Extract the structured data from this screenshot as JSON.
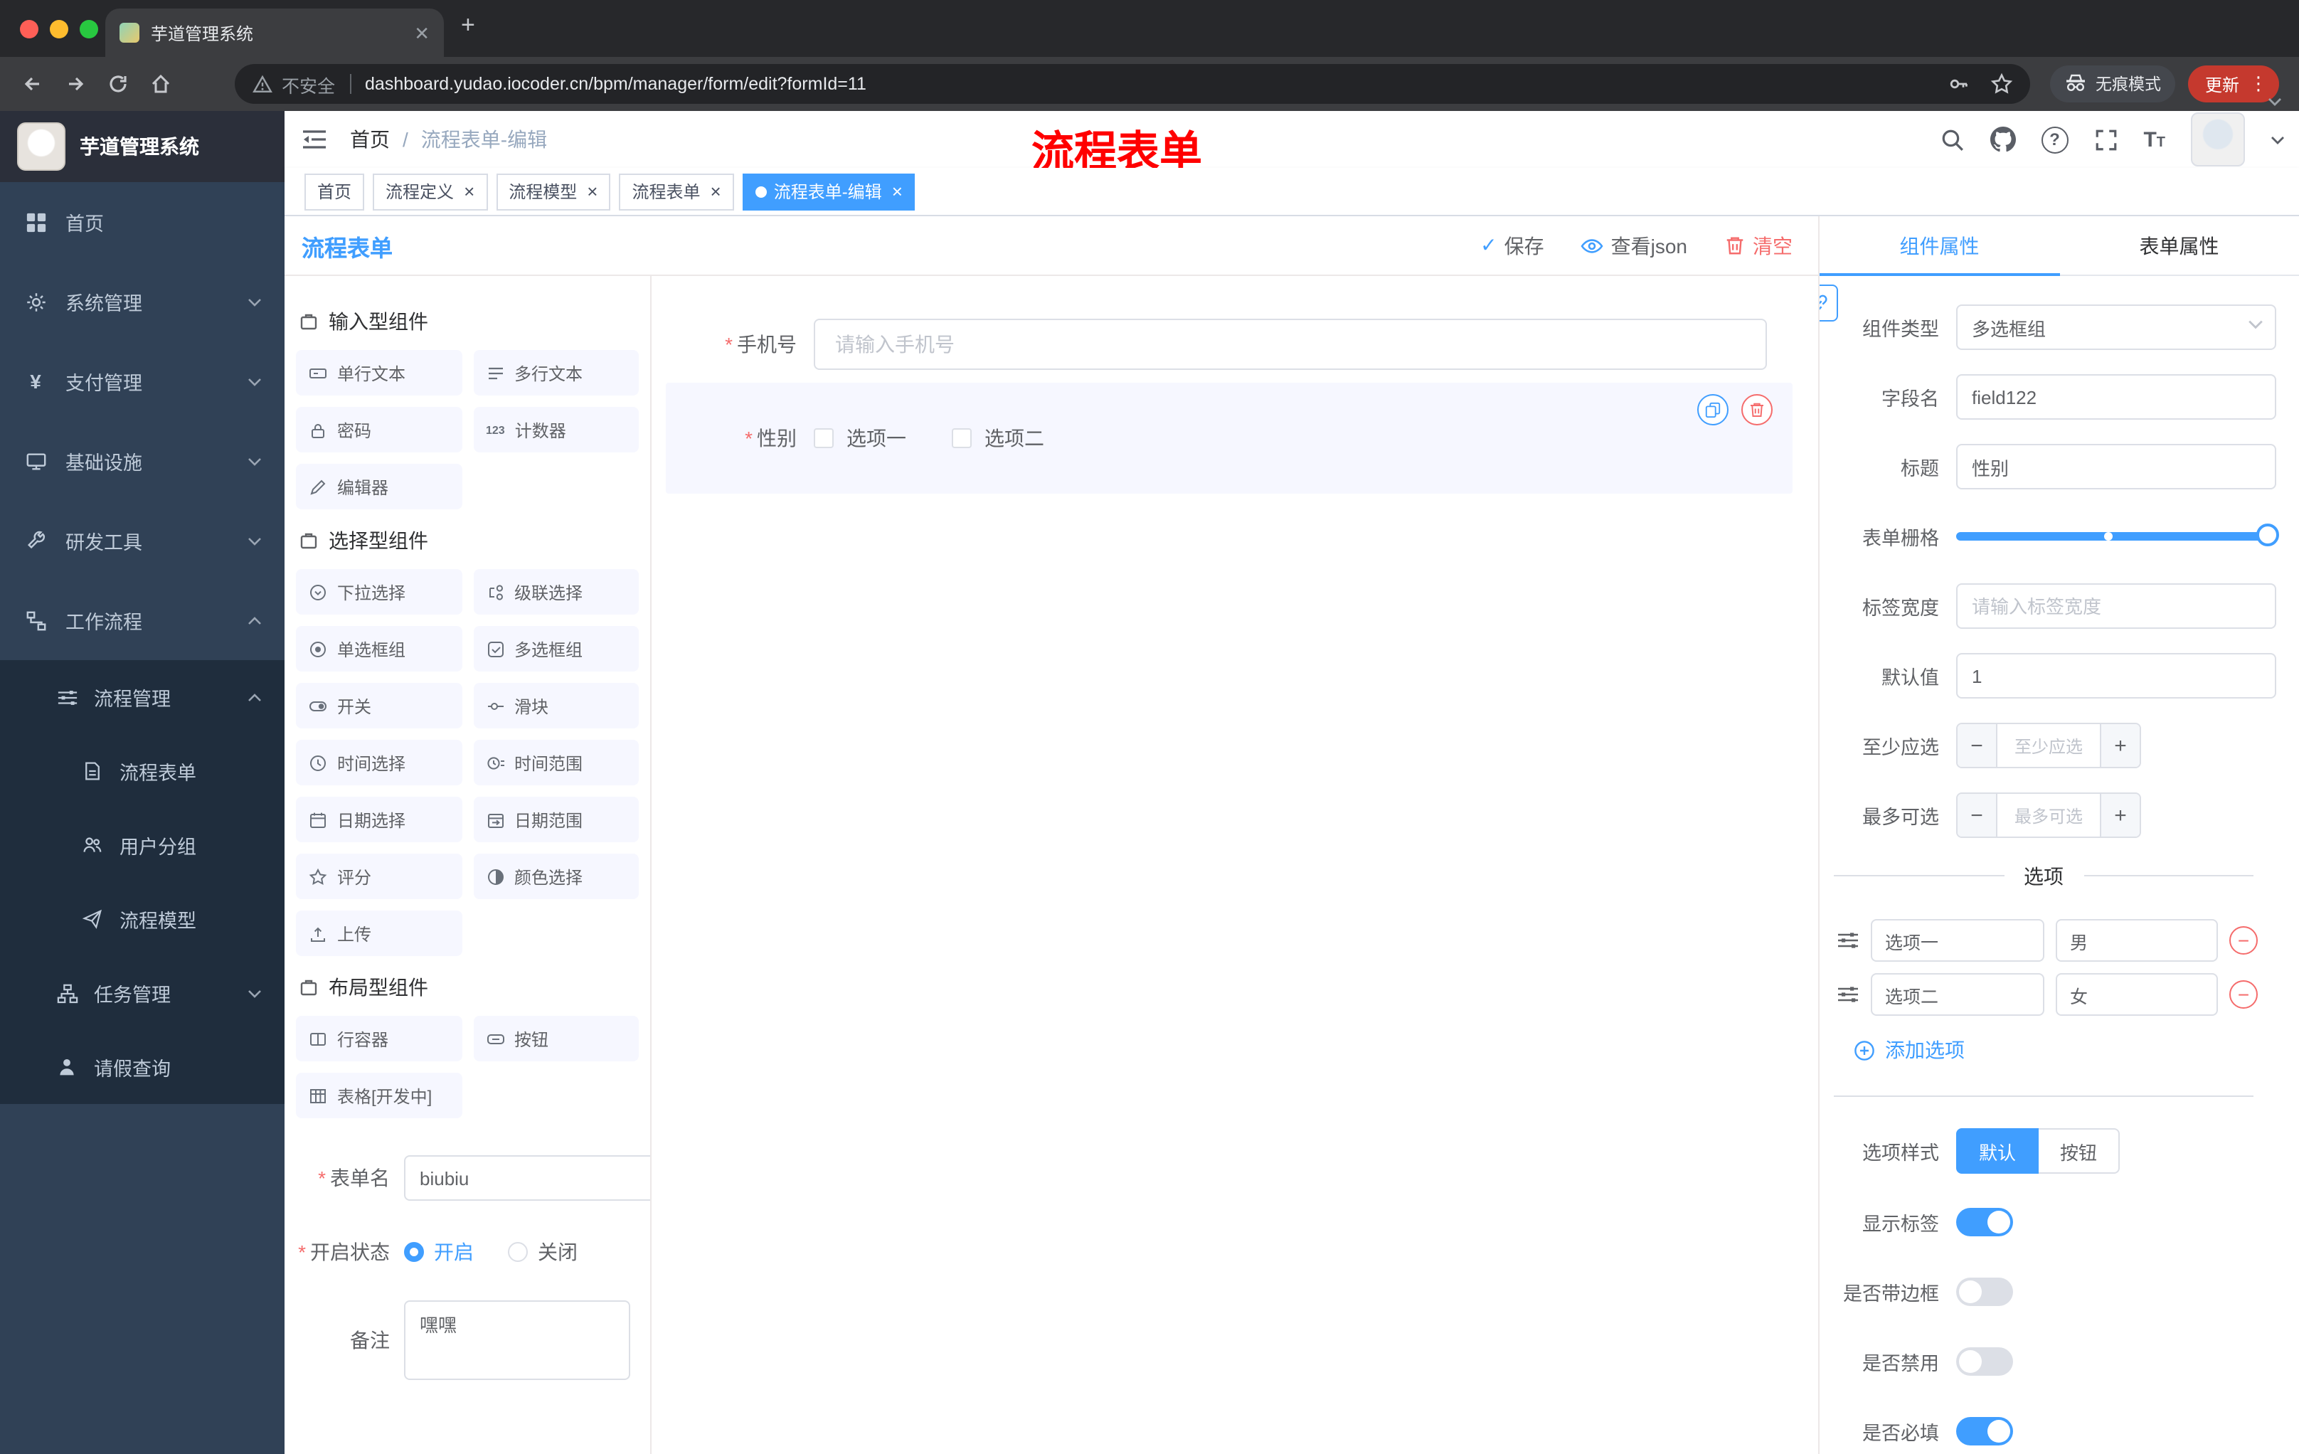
{
  "colors": {
    "primary": "#409EFF",
    "danger": "#F56C6C",
    "update_red": "#C5392E",
    "sidebar_bg": "#304156",
    "submenu_bg": "#1F2D3D"
  },
  "browser": {
    "tab_title": "芋道管理系统",
    "security_label": "不安全",
    "url": "dashboard.yudao.iocoder.cn/bpm/manager/form/edit?formId=11",
    "incognito_label": "无痕模式",
    "update_label": "更新",
    "icons": [
      "back-icon",
      "forward-icon",
      "reload-icon",
      "home-icon",
      "warning-icon",
      "key-icon",
      "star-icon",
      "incognito-icon",
      "more-icon"
    ]
  },
  "sidebar": {
    "logo_title": "芋道管理系统",
    "menu": [
      {
        "label": "首页",
        "icon": "dashboard-icon",
        "chevron": null
      },
      {
        "label": "系统管理",
        "icon": "gear-icon",
        "chevron": "down"
      },
      {
        "label": "支付管理",
        "icon": "yen-icon",
        "chevron": "down"
      },
      {
        "label": "基础设施",
        "icon": "monitor-icon",
        "chevron": "down"
      },
      {
        "label": "研发工具",
        "icon": "wrench-icon",
        "chevron": "down"
      },
      {
        "label": "工作流程",
        "icon": "workflow-icon",
        "chevron": "up",
        "expanded": true
      }
    ],
    "submenu": [
      {
        "label": "流程管理",
        "icon": "operation-icon",
        "chevron": "up",
        "level": 1
      },
      {
        "label": "流程表单",
        "icon": "form-icon",
        "level": 2
      },
      {
        "label": "用户分组",
        "icon": "user-group-icon",
        "level": 2
      },
      {
        "label": "流程模型",
        "icon": "send-icon",
        "level": 2
      },
      {
        "label": "任务管理",
        "icon": "tree-icon",
        "chevron": "down",
        "level": 1
      },
      {
        "label": "请假查询",
        "icon": "person-icon",
        "level": 1
      }
    ]
  },
  "header": {
    "breadcrumb": {
      "root": "首页",
      "separator": "/",
      "current": "流程表单-编辑"
    },
    "annotation": "流程表单",
    "icons": [
      "search-icon",
      "github-icon",
      "question-icon",
      "fullscreen-icon",
      "font-size-icon",
      "avatar",
      "caret-down-icon"
    ]
  },
  "tags": [
    {
      "label": "首页",
      "closable": false,
      "active": false
    },
    {
      "label": "流程定义",
      "closable": true,
      "active": false
    },
    {
      "label": "流程模型",
      "closable": true,
      "active": false
    },
    {
      "label": "流程表单",
      "closable": true,
      "active": false
    },
    {
      "label": "流程表单-编辑",
      "closable": true,
      "active": true
    }
  ],
  "designer": {
    "panel_title": "流程表单",
    "toolbar": {
      "save": "保存",
      "view_json": "查看json",
      "clear": "清空"
    },
    "groups": [
      {
        "title": "输入型组件",
        "items": [
          "单行文本",
          "多行文本",
          "密码",
          "计数器",
          "编辑器"
        ]
      },
      {
        "title": "选择型组件",
        "items": [
          "下拉选择",
          "级联选择",
          "单选框组",
          "多选框组",
          "开关",
          "滑块",
          "时间选择",
          "时间范围",
          "日期选择",
          "日期范围",
          "评分",
          "颜色选择",
          "上传"
        ]
      },
      {
        "title": "布局型组件",
        "items": [
          "行容器",
          "按钮",
          "表格[开发中]"
        ]
      }
    ],
    "form_meta": {
      "name_label": "表单名",
      "name_value": "biubiu",
      "status_label": "开启状态",
      "status_options": [
        "开启",
        "关闭"
      ],
      "status_selected": "开启",
      "remark_label": "备注",
      "remark_value": "嘿嘿"
    },
    "canvas": {
      "phone_label": "手机号",
      "phone_placeholder": "请输入手机号",
      "gender_label": "性别",
      "gender_options": [
        "选项一",
        "选项二"
      ]
    }
  },
  "properties": {
    "tabs": [
      {
        "label": "组件属性",
        "active": true
      },
      {
        "label": "表单属性",
        "active": false
      }
    ],
    "component_type": {
      "label": "组件类型",
      "value": "多选框组"
    },
    "field_name": {
      "label": "字段名",
      "value": "field122"
    },
    "title": {
      "label": "标题",
      "value": "性别"
    },
    "grid": {
      "label": "表单栅格"
    },
    "label_width": {
      "label": "标签宽度",
      "placeholder": "请输入标签宽度"
    },
    "default_value": {
      "label": "默认值",
      "value": "1"
    },
    "min_select": {
      "label": "至少应选",
      "placeholder": "至少应选"
    },
    "max_select": {
      "label": "最多可选",
      "placeholder": "最多可选"
    },
    "options_divider": "选项",
    "options": [
      {
        "label": "选项一",
        "value": "男"
      },
      {
        "label": "选项二",
        "value": "女"
      }
    ],
    "add_option": "添加选项",
    "option_style": {
      "label": "选项样式",
      "choices": [
        "默认",
        "按钮"
      ],
      "selected": "默认"
    },
    "switches": [
      {
        "label": "显示标签",
        "on": true
      },
      {
        "label": "是否带边框",
        "on": false
      },
      {
        "label": "是否禁用",
        "on": false
      },
      {
        "label": "是否必填",
        "on": true
      }
    ]
  }
}
